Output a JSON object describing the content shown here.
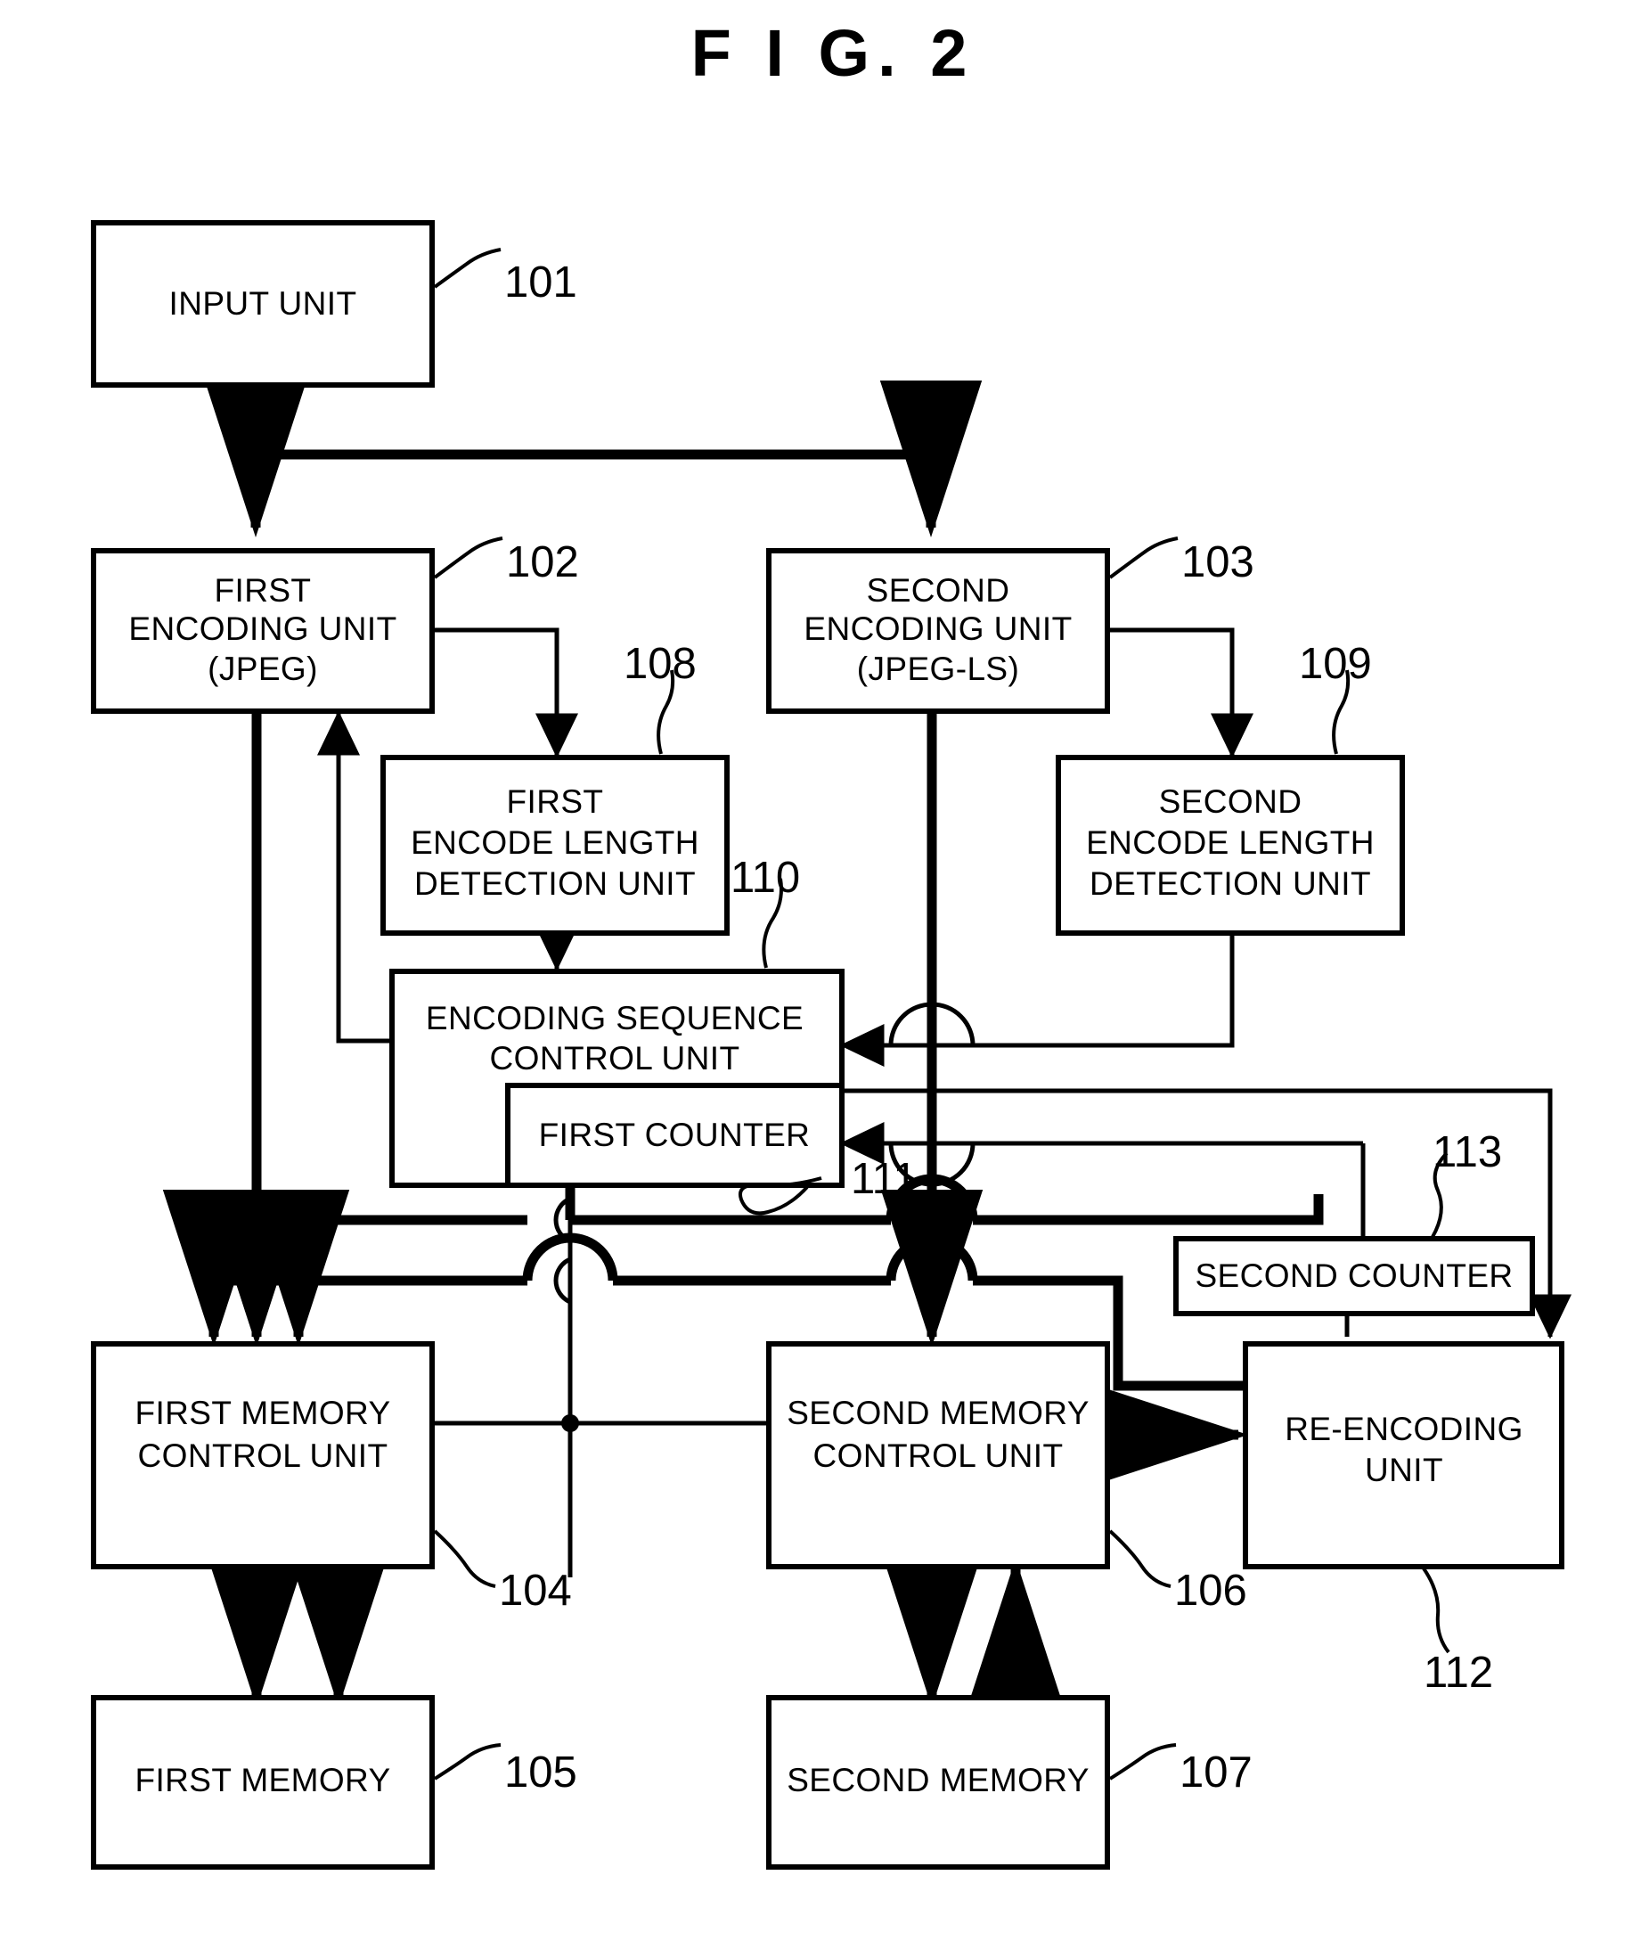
{
  "figure": {
    "title": "F I G.  2",
    "type": "patent-block-diagram"
  },
  "blocks": [
    {
      "id": "input-unit",
      "ref": "101",
      "lines": [
        "INPUT UNIT"
      ]
    },
    {
      "id": "first-encoding-unit",
      "ref": "102",
      "lines": [
        "FIRST",
        "ENCODING UNIT",
        "(JPEG)"
      ]
    },
    {
      "id": "second-encoding-unit",
      "ref": "103",
      "lines": [
        "SECOND",
        "ENCODING UNIT",
        "(JPEG-LS)"
      ]
    },
    {
      "id": "first-memory-control-unit",
      "ref": "104",
      "lines": [
        "FIRST MEMORY",
        "CONTROL UNIT"
      ]
    },
    {
      "id": "first-memory",
      "ref": "105",
      "lines": [
        "FIRST MEMORY"
      ]
    },
    {
      "id": "second-memory-control-unit",
      "ref": "106",
      "lines": [
        "SECOND MEMORY",
        "CONTROL UNIT"
      ]
    },
    {
      "id": "second-memory",
      "ref": "107",
      "lines": [
        "SECOND MEMORY"
      ]
    },
    {
      "id": "first-encode-length-detection-unit",
      "ref": "108",
      "lines": [
        "FIRST",
        "ENCODE LENGTH",
        "DETECTION UNIT"
      ]
    },
    {
      "id": "second-encode-length-detection-unit",
      "ref": "109",
      "lines": [
        "SECOND",
        "ENCODE LENGTH",
        "DETECTION UNIT"
      ]
    },
    {
      "id": "encoding-sequence-control-unit",
      "ref": "110",
      "lines": [
        "ENCODING SEQUENCE",
        "CONTROL UNIT"
      ]
    },
    {
      "id": "first-counter",
      "ref": "111",
      "lines": [
        "FIRST COUNTER"
      ]
    },
    {
      "id": "re-encoding-unit",
      "ref": "112",
      "lines": [
        "RE-ENCODING",
        "UNIT"
      ]
    },
    {
      "id": "second-counter",
      "ref": "113",
      "lines": [
        "SECOND COUNTER"
      ]
    }
  ],
  "labels": {
    "input_unit": "INPUT UNIT",
    "first_encoding_1": "FIRST",
    "first_encoding_2": "ENCODING UNIT",
    "first_encoding_3": "(JPEG)",
    "second_encoding_1": "SECOND",
    "second_encoding_2": "ENCODING UNIT",
    "second_encoding_3": "(JPEG-LS)",
    "first_eld_1": "FIRST",
    "first_eld_2": "ENCODE LENGTH",
    "first_eld_3": "DETECTION UNIT",
    "second_eld_1": "SECOND",
    "second_eld_2": "ENCODE LENGTH",
    "second_eld_3": "DETECTION UNIT",
    "esc_1": "ENCODING SEQUENCE",
    "esc_2": "CONTROL UNIT",
    "first_counter": "FIRST COUNTER",
    "second_counter": "SECOND COUNTER",
    "first_mem_ctrl_1": "FIRST MEMORY",
    "first_mem_ctrl_2": "CONTROL UNIT",
    "second_mem_ctrl_1": "SECOND MEMORY",
    "second_mem_ctrl_2": "CONTROL UNIT",
    "re_encoding_1": "RE-ENCODING",
    "re_encoding_2": "UNIT",
    "first_memory": "FIRST MEMORY",
    "second_memory": "SECOND MEMORY"
  },
  "refs": {
    "r101": "101",
    "r102": "102",
    "r103": "103",
    "r104": "104",
    "r105": "105",
    "r106": "106",
    "r107": "107",
    "r108": "108",
    "r109": "109",
    "r110": "110",
    "r111": "111",
    "r112": "112",
    "r113": "113"
  },
  "colors": {
    "ink": "#000000",
    "paper": "#ffffff"
  }
}
